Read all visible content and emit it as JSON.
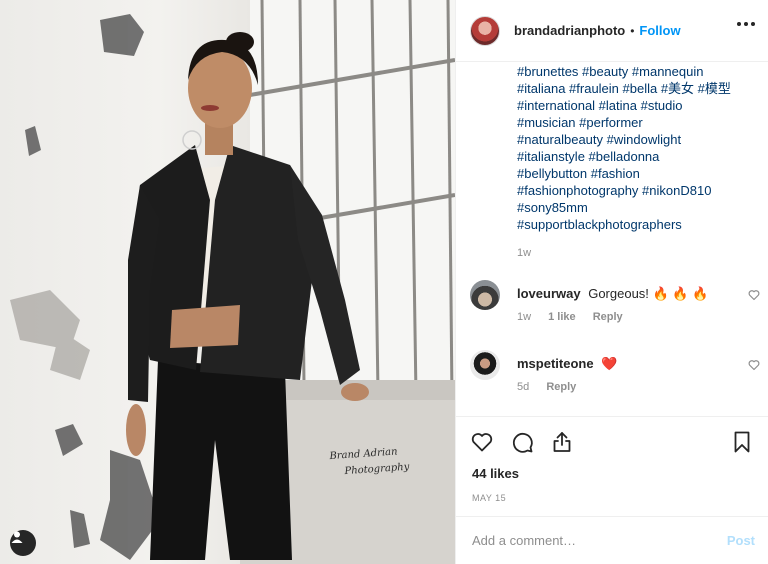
{
  "post": {
    "username": "brandadrianphoto",
    "separator": "•",
    "follow_label": "Follow",
    "photo_signature": [
      "Brand Adrian",
      "Photography"
    ]
  },
  "caption": {
    "lines": [
      "#brunettes #beauty #mannequin",
      "#italiana #fraulein #bella #美女 #模型",
      "#international #latina #studio",
      "#musician #performer",
      "#naturalbeauty #windowlight",
      "#italianstyle #belladonna",
      "#bellybutton #fashion",
      "#fashionphotography #nikonD810",
      "#sony85mm",
      "#supportblackphotographers"
    ],
    "age": "1w"
  },
  "comments": [
    {
      "username": "loveurway",
      "text": "Gorgeous! 🔥 🔥 🔥",
      "age": "1w",
      "likes": "1 like",
      "reply_label": "Reply"
    },
    {
      "username": "mspetiteone",
      "text": "❤️",
      "age": "5d",
      "reply_label": "Reply"
    }
  ],
  "actions": {
    "likes": "44 likes",
    "date": "MAY 15"
  },
  "comment_box": {
    "placeholder": "Add a comment…",
    "post_label": "Post"
  },
  "colors": {
    "link_blue": "#0095f6",
    "hashtag": "#00376b",
    "muted": "#8e8e8e",
    "post_disabled": "#b2dffc"
  },
  "icons": [
    "heart-icon",
    "comment-icon",
    "share-icon",
    "bookmark-icon",
    "user-tag-icon",
    "more-options-icon"
  ]
}
